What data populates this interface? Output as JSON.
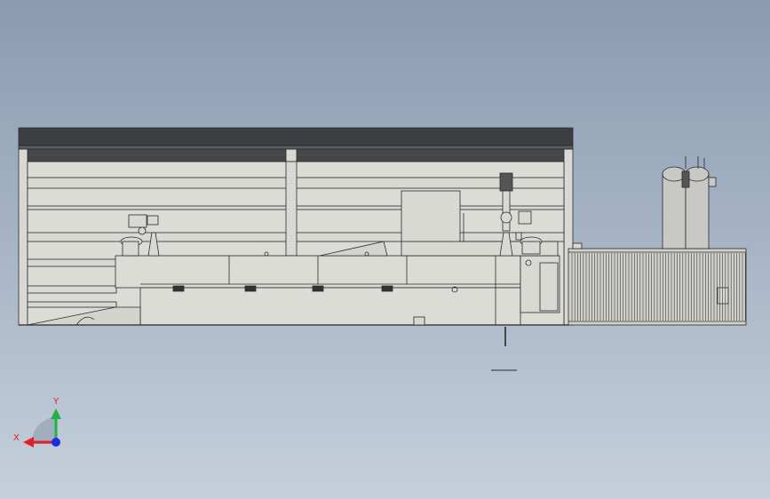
{
  "view": {
    "background_top": "#8b9bb0",
    "background_bottom": "#c6d0dc"
  },
  "model_colors": {
    "roof": "#3c3f42",
    "frame_fill": "#d9d9d4",
    "body_fill": "#dcdcd6",
    "line": "#2a2a2a",
    "tank_fill": "#c8c8c4",
    "radiator_fill": "#d2d2cc"
  },
  "triad": {
    "x_label": "X",
    "y_label": "Y",
    "x_color": "#e0202a",
    "y_color": "#22b04a",
    "z_color": "#1c2ee0"
  }
}
